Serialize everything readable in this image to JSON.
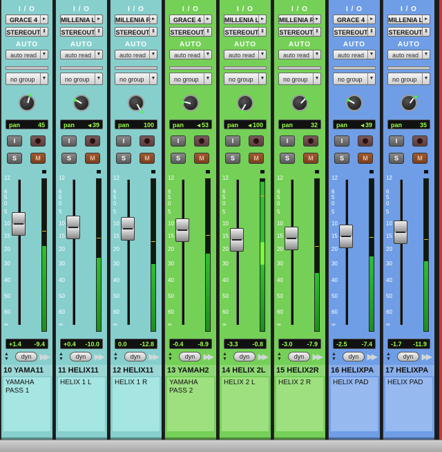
{
  "io_label": "I / O",
  "auto_label": "AUTO",
  "group_label": "no group",
  "pan_label": "pan",
  "dyn_label": "dyn",
  "fader_scale": [
    "12",
    "6",
    "5",
    "0",
    "5",
    "10",
    "15",
    "20",
    "30",
    "40",
    "50",
    "60",
    "∞"
  ],
  "colors": {
    "teal": "#86cfcd",
    "green": "#74d056",
    "blue": "#6f9ee6",
    "comment_teal": "#a5e5e2",
    "comment_green": "#9ee07f",
    "comment_blue": "#96b9f0"
  },
  "channels": [
    {
      "color": "teal",
      "input": "GRACE 4",
      "output": "STEREOUT",
      "auto": "auto read",
      "pan": "45",
      "pan_dir": "",
      "pan_pos": 0.55,
      "vol": "+1.4",
      "peak": "-9.4",
      "fader": 0.74,
      "meter": 0.56,
      "name": "10 YAMA11",
      "comment": "YAMAHA PASS 1"
    },
    {
      "color": "teal",
      "input": "MILLENIA L",
      "output": "STEREOUT",
      "auto": "auto read",
      "pan": "39",
      "pan_dir": "◂",
      "pan_pos": 0.3,
      "vol": "+0.4",
      "peak": "-10.0",
      "fader": 0.71,
      "meter": 0.48,
      "name": "11 HELIX11",
      "comment": "HELIX 1 L"
    },
    {
      "color": "teal",
      "input": "MILLENIA R",
      "output": "STEREOUT",
      "auto": "auto read",
      "pan": "100",
      "pan_dir": "",
      "pan_pos": 1.0,
      "vol": "0.0",
      "peak": "-12.8",
      "fader": 0.7,
      "meter": 0.44,
      "name": "12 HELIX11",
      "comment": "HELIX 1 R"
    },
    {
      "color": "green",
      "input": "GRACE 4",
      "output": "STEREOUT",
      "auto": "auto read",
      "pan": "53",
      "pan_dir": "◂",
      "pan_pos": 0.25,
      "vol": "-0.4",
      "peak": "-8.9",
      "fader": 0.69,
      "meter": 0.51,
      "name": "13 YAMAH2",
      "comment": "YAMAHA PASS 2"
    },
    {
      "color": "green",
      "input": "MILLENIA L",
      "output": "STEREOUT",
      "auto": "auto read",
      "pan": "100",
      "pan_dir": "◂",
      "pan_pos": 0.0,
      "vol": "-3.3",
      "peak": "-0.8",
      "fader": 0.61,
      "meter": 0.98,
      "name": "14 HELIX 2L",
      "comment": "HELIX 2 L"
    },
    {
      "color": "green",
      "input": "MILLENIA R",
      "output": "STEREOUT",
      "auto": "auto read",
      "pan": "32",
      "pan_dir": "",
      "pan_pos": 0.65,
      "vol": "-3.0",
      "peak": "-7.9",
      "fader": 0.62,
      "meter": 0.38,
      "name": "15 HELIX2R",
      "comment": "HELIX 2 R"
    },
    {
      "color": "blue",
      "input": "GRACE 4",
      "output": "STEREOUT",
      "auto": "auto read",
      "pan": "39",
      "pan_dir": "◂",
      "pan_pos": 0.3,
      "vol": "-2.5",
      "peak": "-7.4",
      "fader": 0.64,
      "meter": 0.49,
      "name": "16 HELIXPA",
      "comment": "HELIX PAD"
    },
    {
      "color": "blue",
      "input": "MILLENIA L",
      "output": "STEREOUT",
      "auto": "auto read",
      "pan": "35",
      "pan_dir": "",
      "pan_pos": 0.62,
      "vol": "-1.7",
      "peak": "-11.9",
      "fader": 0.67,
      "meter": 0.46,
      "name": "17 HELIXPA",
      "comment": "HELIX PAD"
    }
  ]
}
